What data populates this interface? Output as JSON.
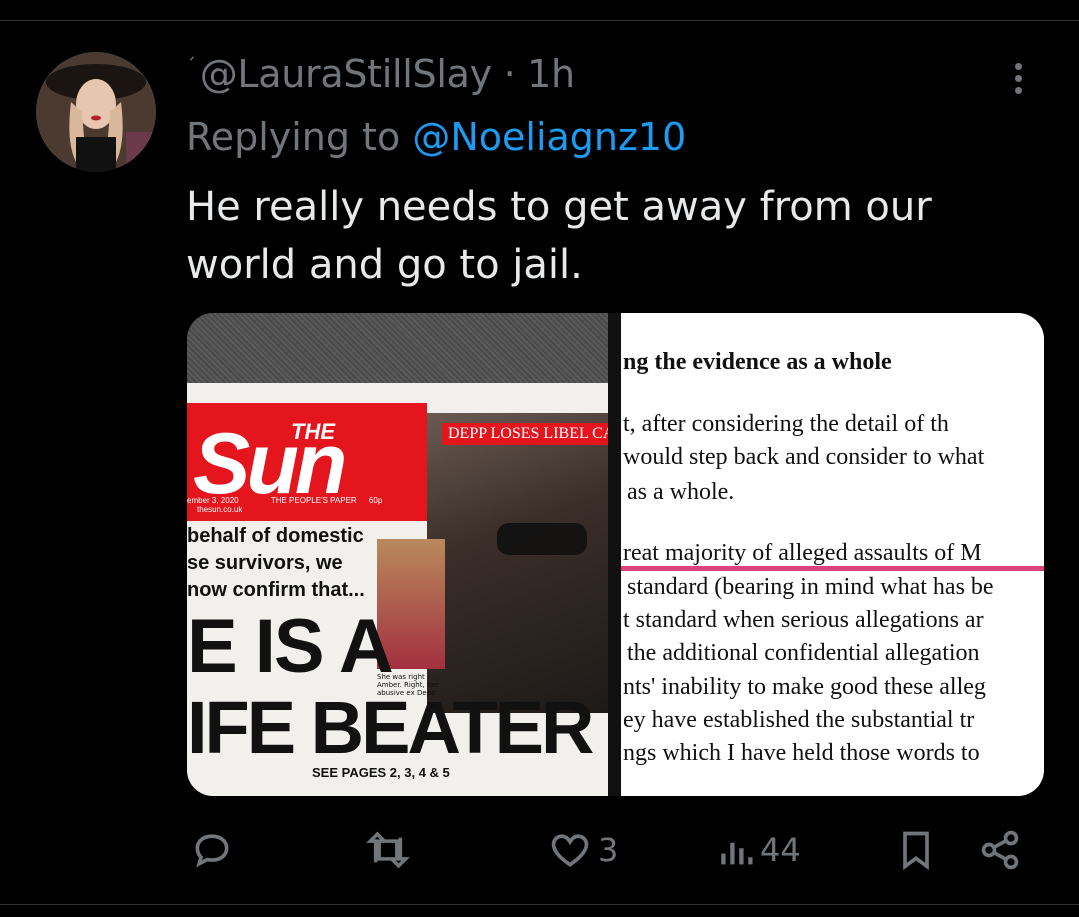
{
  "post": {
    "handle": "@LauraStillSlay",
    "time": "1h",
    "separator": "·",
    "replying_prefix": "Replying to",
    "replying_handle": "@Noeliagnz10",
    "text": "He really needs to get away from our world and go to jail."
  },
  "media": {
    "left": {
      "the": "THE",
      "sun": "Sun",
      "depp_loses": "DEPP LOSES LIBEL CA",
      "date": "ember 3, 2020",
      "peoples_paper": "THE PEOPLE'S PAPER",
      "price": "60p",
      "url": "thesun.co.uk",
      "dv_line1": "behalf of domestic",
      "dv_line2": "se survivors, we",
      "dv_line3": "now confirm that...",
      "isa": "E IS A",
      "beater": "IFE BEATER",
      "inset_caption": "She was right . . . Amber. Right, her abusive ex Depp",
      "see_pages": "SEE PAGES 2, 3, 4 & 5"
    },
    "right": {
      "heading": "ng the evidence as a whole",
      "lines": [
        "t, after considering the detail of th",
        "would step back and consider to what",
        "as a whole.",
        "reat majority of alleged assaults of M",
        "standard (bearing in mind what has be",
        "t standard when serious allegations ar",
        "the additional confidential allegation",
        "nts' inability to make good these alleg",
        "ey have established the substantial tr",
        "ngs which I have held those words to"
      ]
    }
  },
  "actions": {
    "reply_count": "",
    "retweet_count": "",
    "like_count": "3",
    "views_count": "44"
  },
  "colors": {
    "link": "#1d9bf0",
    "muted": "#71767b",
    "text": "#e7e9ea",
    "sun_red": "#e4151d",
    "highlight": "#d9457a"
  }
}
